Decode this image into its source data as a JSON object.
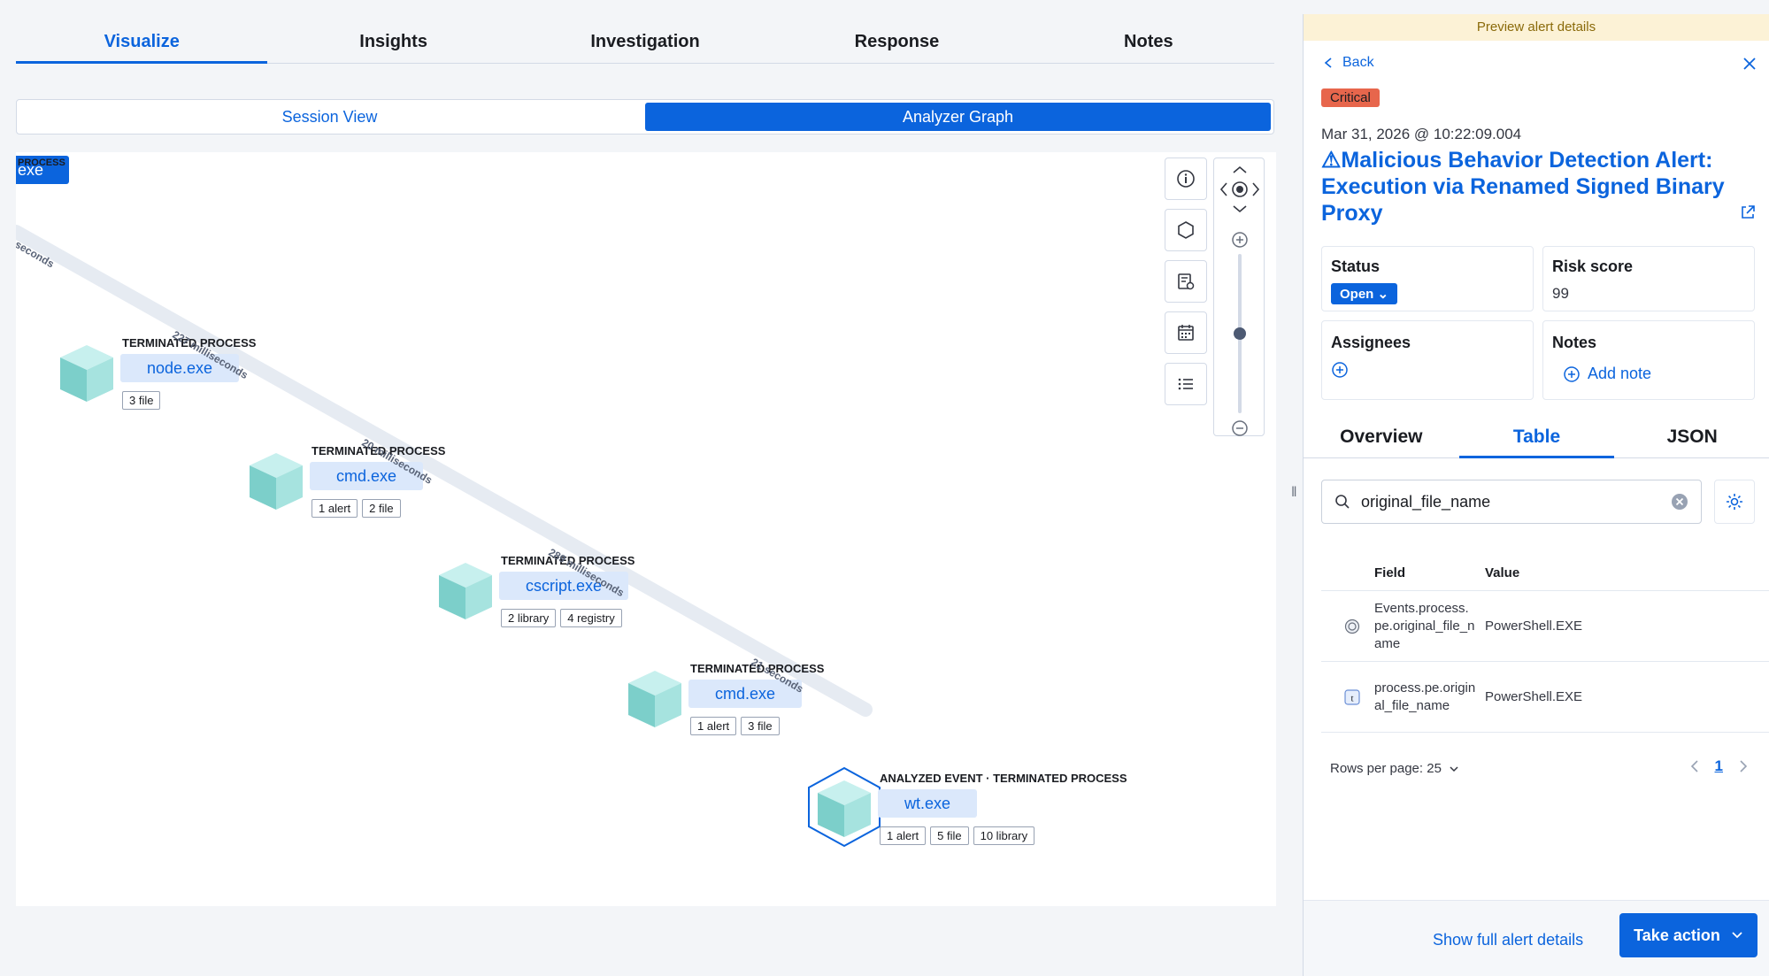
{
  "main_tabs": [
    {
      "label": "Visualize",
      "active": true
    },
    {
      "label": "Insights"
    },
    {
      "label": "Investigation"
    },
    {
      "label": "Response"
    },
    {
      "label": "Notes"
    }
  ],
  "view_toggle": {
    "session": "Session View",
    "analyzer": "Analyzer Graph",
    "selected": "Analyzer Graph"
  },
  "graph": {
    "cutoff_node": {
      "name": "exe",
      "title": "PROCESS"
    },
    "cutoff_edge_label": "seconds",
    "nodes": [
      {
        "title": "TERMINATED PROCESS",
        "name": "node.exe",
        "pills": [
          "3 file"
        ]
      },
      {
        "title": "TERMINATED PROCESS",
        "name": "cmd.exe",
        "pills": [
          "1 alert",
          "2 file"
        ]
      },
      {
        "title": "TERMINATED PROCESS",
        "name": "cscript.exe",
        "pills": [
          "2 library",
          "4 registry"
        ]
      },
      {
        "title": "TERMINATED PROCESS",
        "name": "cmd.exe",
        "pills": [
          "1 alert",
          "3 file"
        ]
      },
      {
        "title": "ANALYZED EVENT · TERMINATED PROCESS",
        "name": "wt.exe",
        "pills": [
          "1 alert",
          "5 file",
          "10 library"
        ],
        "analyzed": true
      }
    ],
    "edge_labels": [
      "227 milliseconds",
      "20 milliseconds",
      "289 milliseconds",
      "21 seconds"
    ],
    "controls": [
      "info-icon",
      "hexagon-icon",
      "settings-list-icon",
      "calendar-icon",
      "list-icon"
    ],
    "zoom_level": 0.5
  },
  "flyout": {
    "banner": "Preview alert details",
    "back": "Back",
    "severity": "Critical",
    "timestamp": "Mar 31, 2026 @ 10:22:09.004",
    "title": "Malicious Behavior Detection Alert: Execution via Renamed Signed Binary Proxy",
    "status_label": "Status",
    "status_value": "Open",
    "risk_label": "Risk score",
    "risk_value": "99",
    "assignees_label": "Assignees",
    "notes_label": "Notes",
    "add_note": "Add note",
    "tabs": [
      {
        "label": "Overview"
      },
      {
        "label": "Table",
        "active": true
      },
      {
        "label": "JSON"
      }
    ],
    "search_value": "original_file_name",
    "table": {
      "headers": [
        "Field",
        "Value"
      ],
      "rows": [
        {
          "field": "Events.process.pe.original_file_name",
          "value": "PowerShell.EXE",
          "type_icon": "geo-type-icon"
        },
        {
          "field": "process.pe.original_file_name",
          "value": "PowerShell.EXE",
          "type_icon": "text-type-icon"
        }
      ]
    },
    "rows_per_page": "Rows per page: 25",
    "page": "1",
    "show_full": "Show full alert details",
    "take_action": "Take action"
  },
  "colors": {
    "primary": "#0b64dd",
    "critical": "#e7664c",
    "banner": "#fcf2d6",
    "node_fill": "#dbe8fb"
  }
}
